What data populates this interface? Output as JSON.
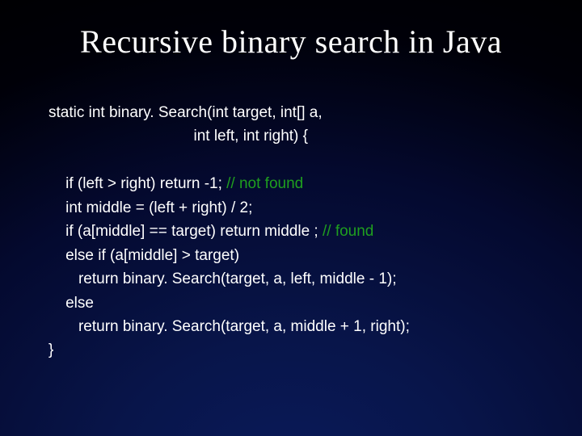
{
  "title": "Recursive binary search in Java",
  "code": {
    "l1": "static int binary. Search(int target, int[] a,",
    "l2": "                                  int left, int right) {",
    "l3": "",
    "l4_a": "    if (left > right) return -1; ",
    "l4_c": "// not found",
    "l5": "    int middle = (left + right) / 2;",
    "l6_a": "    if (a[middle] == target) return middle ; ",
    "l6_c": "// found",
    "l7": "    else if (a[middle] > target)",
    "l8": "       return binary. Search(target, a, left, middle - 1);",
    "l9": "    else",
    "l10": "       return binary. Search(target, a, middle + 1, right);",
    "l11": "}"
  }
}
